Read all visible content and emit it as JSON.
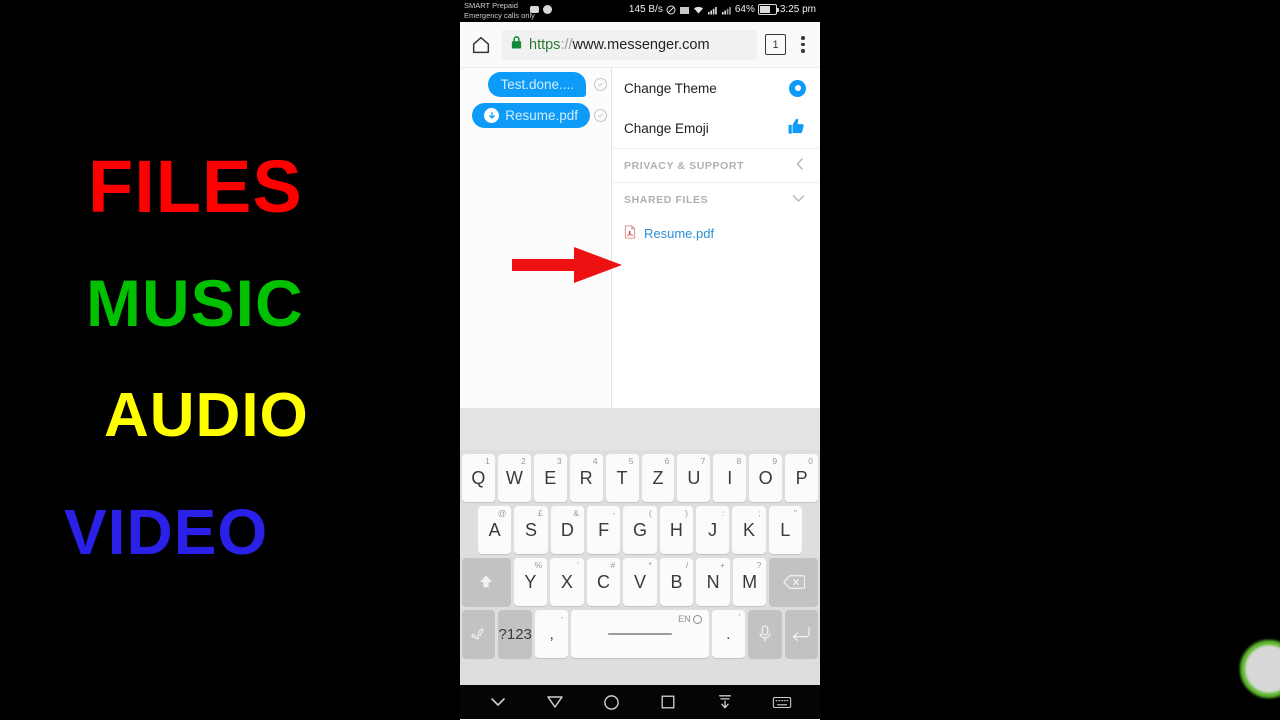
{
  "promo": {
    "words": [
      {
        "text": "FILES",
        "color": "#ff0000"
      },
      {
        "text": "MUSIC",
        "color": "#00c000"
      },
      {
        "text": "AUDIO",
        "color": "#ffff00"
      },
      {
        "text": "VIDEO",
        "color": "#2a20e8"
      }
    ]
  },
  "statusbar": {
    "carrier_line1": "SMART Prepaid",
    "carrier_line2": "Emergency calls only",
    "network_speed": "145 B/s",
    "battery_percent": "64%",
    "clock": "3:25 pm"
  },
  "browser": {
    "home_icon": "home-icon",
    "lock_icon": "lock-icon",
    "url_scheme": "https",
    "url_separator": "://",
    "url_host": "www.messenger.com",
    "url_full": "https://www.messenger.com",
    "tab_count": "1",
    "menu_icon": "overflow-menu-icon"
  },
  "chat": {
    "messages": [
      {
        "text": "Test.done....",
        "has_download_icon": false,
        "status": "delivered"
      },
      {
        "text": "Resume.pdf",
        "has_download_icon": true,
        "status": "delivered"
      }
    ]
  },
  "settings_panel": {
    "rows": [
      {
        "label": "Change Theme",
        "icon": "theme-circle-icon"
      },
      {
        "label": "Change Emoji",
        "icon": "thumbs-up-icon"
      }
    ],
    "sections": [
      {
        "label": "PRIVACY & SUPPORT",
        "chevron": "chevron-left-icon"
      },
      {
        "label": "SHARED FILES",
        "chevron": "chevron-down-icon"
      }
    ],
    "shared_files": [
      {
        "name": "Resume.pdf",
        "icon": "pdf-file-icon"
      }
    ]
  },
  "annotation": {
    "arrow_color": "#ee1111",
    "arrow_name": "red-pointer-arrow"
  },
  "keyboard": {
    "language": "EN",
    "rows": [
      {
        "keys": [
          {
            "label": "Q",
            "sup": "1"
          },
          {
            "label": "W",
            "sup": "2"
          },
          {
            "label": "E",
            "sup": "3"
          },
          {
            "label": "R",
            "sup": "4"
          },
          {
            "label": "T",
            "sup": "5"
          },
          {
            "label": "Z",
            "sup": "6"
          },
          {
            "label": "U",
            "sup": "7"
          },
          {
            "label": "I",
            "sup": "8"
          },
          {
            "label": "O",
            "sup": "9"
          },
          {
            "label": "P",
            "sup": "0"
          }
        ]
      },
      {
        "keys": [
          {
            "label": "A",
            "sup": "@"
          },
          {
            "label": "S",
            "sup": "£"
          },
          {
            "label": "D",
            "sup": "&"
          },
          {
            "label": "F",
            "sup": "-"
          },
          {
            "label": "G",
            "sup": "("
          },
          {
            "label": "H",
            "sup": ")"
          },
          {
            "label": "J",
            "sup": ":"
          },
          {
            "label": "K",
            "sup": ";"
          },
          {
            "label": "L",
            "sup": "\""
          }
        ]
      },
      {
        "keys": [
          {
            "label": "",
            "sup": "",
            "icon": "shift-icon",
            "dark": true
          },
          {
            "label": "Y",
            "sup": "%"
          },
          {
            "label": "X",
            "sup": "'"
          },
          {
            "label": "C",
            "sup": "#"
          },
          {
            "label": "V",
            "sup": "*"
          },
          {
            "label": "B",
            "sup": "/"
          },
          {
            "label": "N",
            "sup": "+"
          },
          {
            "label": "M",
            "sup": "?"
          },
          {
            "label": "",
            "sup": "",
            "icon": "backspace-icon",
            "dark": true
          }
        ]
      },
      {
        "keys": [
          {
            "label": "",
            "sup": "",
            "icon": "handwriting-icon",
            "dark": true
          },
          {
            "label": "?123",
            "sup": "",
            "dark": true
          },
          {
            "label": ",",
            "sup": ""
          },
          {
            "label": "",
            "sup": "",
            "icon": "space-icon"
          },
          {
            "label": ".",
            "sup": ""
          },
          {
            "label": "",
            "sup": "",
            "icon": "microphone-icon",
            "dark": true
          },
          {
            "label": "",
            "sup": "",
            "icon": "enter-icon",
            "dark": true
          }
        ]
      }
    ]
  },
  "navbar": {
    "buttons": [
      {
        "icon": "hide-keyboard-chevron-icon"
      },
      {
        "icon": "back-triangle-icon"
      },
      {
        "icon": "home-circle-icon"
      },
      {
        "icon": "recents-square-icon"
      },
      {
        "icon": "download-arrow-icon"
      },
      {
        "icon": "keyboard-switch-icon"
      }
    ]
  }
}
